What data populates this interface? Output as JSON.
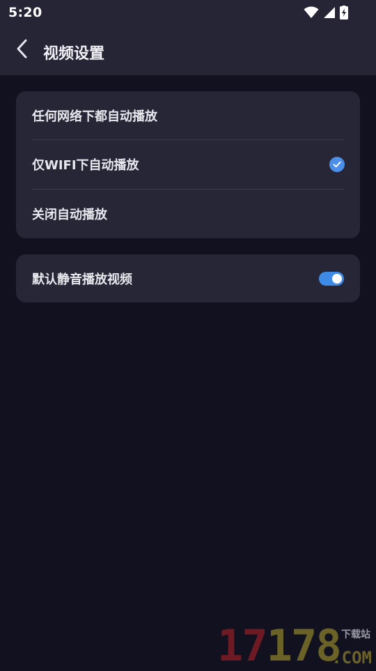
{
  "status_bar": {
    "time": "5:20",
    "icons": [
      "wifi-icon",
      "signal-icon",
      "battery-charging-icon"
    ]
  },
  "header": {
    "title": "视频设置",
    "back_icon": "chevron-left-icon"
  },
  "autoplay_options": {
    "items": [
      {
        "label": "任何网络下都自动播放",
        "selected": false
      },
      {
        "label": "仅WIFI下自动播放",
        "selected": true
      },
      {
        "label": "关闭自动播放",
        "selected": false
      }
    ],
    "check_color": "#4b8fe8"
  },
  "mute_setting": {
    "label": "默认静音播放视频",
    "enabled": true,
    "toggle_color": "#3d8be6"
  },
  "watermark": {
    "digits": "17178",
    "tag": "下载站",
    "domain": ".COM"
  },
  "colors": {
    "background": "#121120",
    "topbar": "#262536",
    "card": "#272637",
    "divider": "#3d3c4f"
  }
}
